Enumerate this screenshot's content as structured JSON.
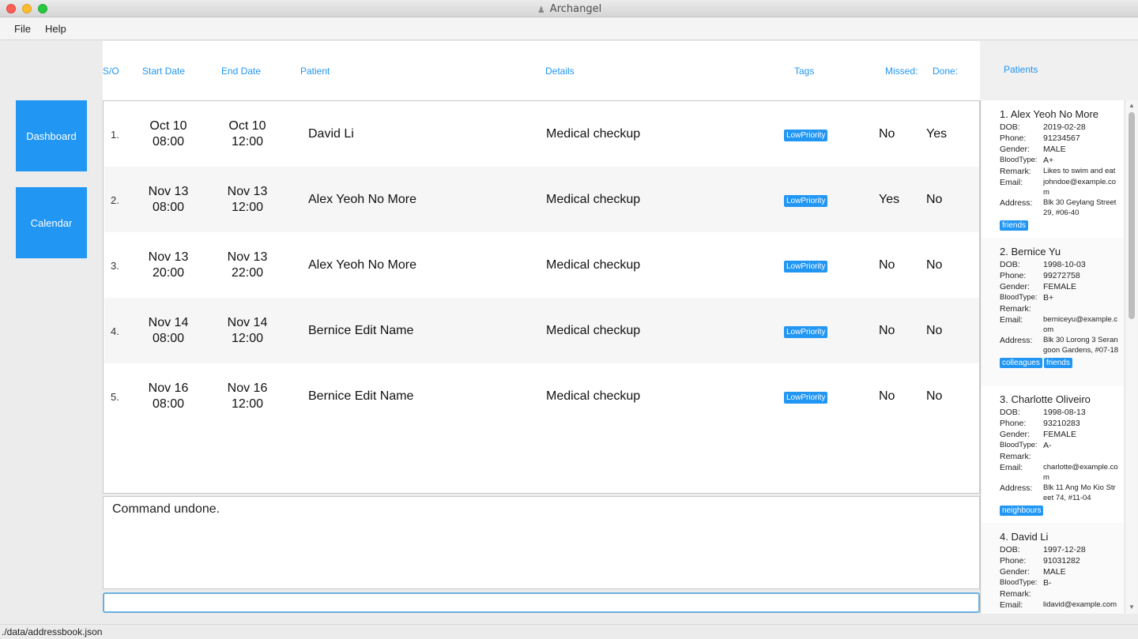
{
  "window": {
    "title": "Archangel"
  },
  "menu": {
    "file": "File",
    "help": "Help"
  },
  "nav": {
    "dashboard": "Dashboard",
    "calendar": "Calendar"
  },
  "table": {
    "headers": {
      "sno": "S/O",
      "start": "Start Date",
      "end": "End Date",
      "patient": "Patient",
      "details": "Details",
      "tags": "Tags",
      "missed": "Missed:",
      "done": "Done:"
    },
    "rows": [
      {
        "sno": "1.",
        "start_date": "Oct 10",
        "start_time": "08:00",
        "end_date": "Oct 10",
        "end_time": "12:00",
        "patient": "David Li",
        "details": "Medical checkup",
        "tag": "LowPriority",
        "missed": "No",
        "done": "Yes"
      },
      {
        "sno": "2.",
        "start_date": "Nov 13",
        "start_time": "08:00",
        "end_date": "Nov 13",
        "end_time": "12:00",
        "patient": "Alex Yeoh No More",
        "details": "Medical checkup",
        "tag": "LowPriority",
        "missed": "Yes",
        "done": "No"
      },
      {
        "sno": "3.",
        "start_date": "Nov 13",
        "start_time": "20:00",
        "end_date": "Nov 13",
        "end_time": "22:00",
        "patient": "Alex Yeoh No More",
        "details": "Medical checkup",
        "tag": "LowPriority",
        "missed": "No",
        "done": "No"
      },
      {
        "sno": "4.",
        "start_date": "Nov 14",
        "start_time": "08:00",
        "end_date": "Nov 14",
        "end_time": "12:00",
        "patient": "Bernice Edit Name",
        "details": "Medical checkup",
        "tag": "LowPriority",
        "missed": "No",
        "done": "No"
      },
      {
        "sno": "5.",
        "start_date": "Nov 16",
        "start_time": "08:00",
        "end_date": "Nov 16",
        "end_time": "12:00",
        "patient": "Bernice Edit Name",
        "details": "Medical checkup",
        "tag": "LowPriority",
        "missed": "No",
        "done": "No"
      }
    ]
  },
  "result": {
    "text": "Command undone."
  },
  "command": {
    "value": ""
  },
  "status": {
    "path": "./data/addressbook.json"
  },
  "patients": {
    "title": "Patients",
    "labels": {
      "dob": "DOB:",
      "phone": "Phone:",
      "gender": "Gender:",
      "blood": "BloodType:",
      "remark": "Remark:",
      "email": "Email:",
      "address": "Address:"
    },
    "items": [
      {
        "name": "1. Alex Yeoh No More",
        "dob": "2019-02-28",
        "phone": "91234567",
        "gender": "MALE",
        "blood": "A+",
        "remark": "Likes to swim and eat",
        "email": "johndoe@example.com",
        "address": "Blk 30 Geylang Street 29, #06-40",
        "tags": [
          "friends"
        ]
      },
      {
        "name": "2. Bernice Yu",
        "dob": "1998-10-03",
        "phone": "99272758",
        "gender": "FEMALE",
        "blood": "B+",
        "remark": "",
        "email": "berniceyu@example.com",
        "address": "Blk 30 Lorong 3 Serangoon Gardens, #07-18",
        "tags": [
          "colleagues",
          "friends"
        ]
      },
      {
        "name": "3. Charlotte Oliveiro",
        "dob": "1998-08-13",
        "phone": "93210283",
        "gender": "FEMALE",
        "blood": "A-",
        "remark": "",
        "email": "charlotte@example.com",
        "address": "Blk 11 Ang Mo Kio Street 74, #11-04",
        "tags": [
          "neighbours"
        ]
      },
      {
        "name": "4. David Li",
        "dob": "1997-12-28",
        "phone": "91031282",
        "gender": "MALE",
        "blood": "B-",
        "remark": "",
        "email": "lidavid@example.com",
        "address": "",
        "tags": []
      }
    ]
  },
  "colors": {
    "accent": "#2196f3"
  }
}
